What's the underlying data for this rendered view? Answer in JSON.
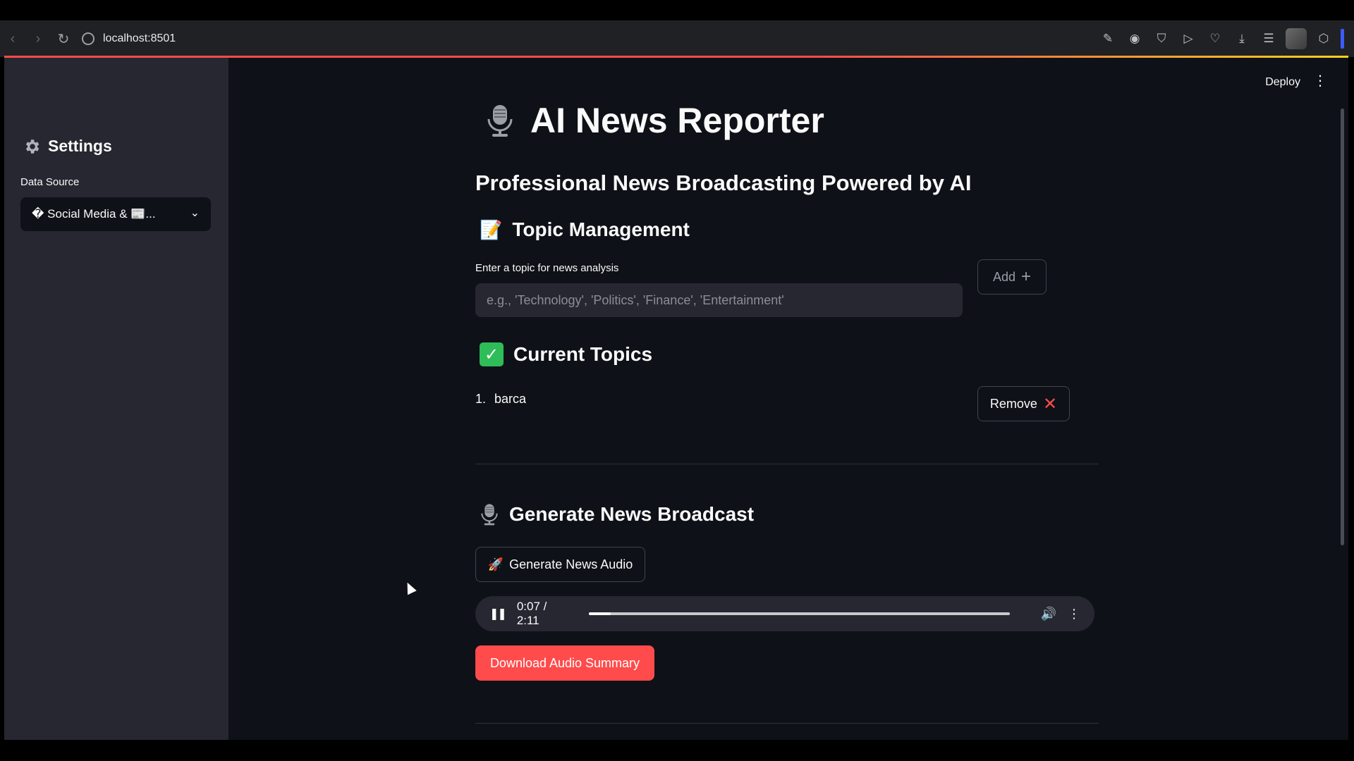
{
  "browser": {
    "url": "localhost:8501",
    "icons": [
      "back-icon",
      "forward-icon",
      "reload-icon",
      "site-info-icon",
      "edit-icon",
      "camera-icon",
      "shield-icon",
      "play-icon",
      "heart-icon",
      "download-icon",
      "menu-icon",
      "profile-avatar",
      "extensions-icon"
    ]
  },
  "sidebar": {
    "title": "Settings",
    "data_source_label": "Data Source",
    "data_source_value": "� Social Media & 📰..."
  },
  "header": {
    "deploy_label": "Deploy",
    "more_icon": "⋮"
  },
  "main": {
    "title": "AI News Reporter",
    "subtitle": "Professional News Broadcasting Powered by AI",
    "topic_management": {
      "heading": "Topic Management",
      "input_label": "Enter a topic for news analysis",
      "input_placeholder": "e.g., 'Technology', 'Politics', 'Finance', 'Entertainment'",
      "add_label": "Add"
    },
    "current_topics": {
      "heading": "Current Topics",
      "items": [
        {
          "number": "1.",
          "name": "barca"
        }
      ],
      "remove_label": "Remove"
    },
    "generate": {
      "heading": "Generate News Broadcast",
      "button_label": "Generate News Audio",
      "audio_time": "0:07 / 2:11",
      "audio_progress": 0.053,
      "download_label": "Download Audio Summary"
    }
  },
  "colors": {
    "accent": "#ff4b4b",
    "app_bg": "#0e1117",
    "sidebar_bg": "#262730",
    "check": "#2ebd59"
  }
}
